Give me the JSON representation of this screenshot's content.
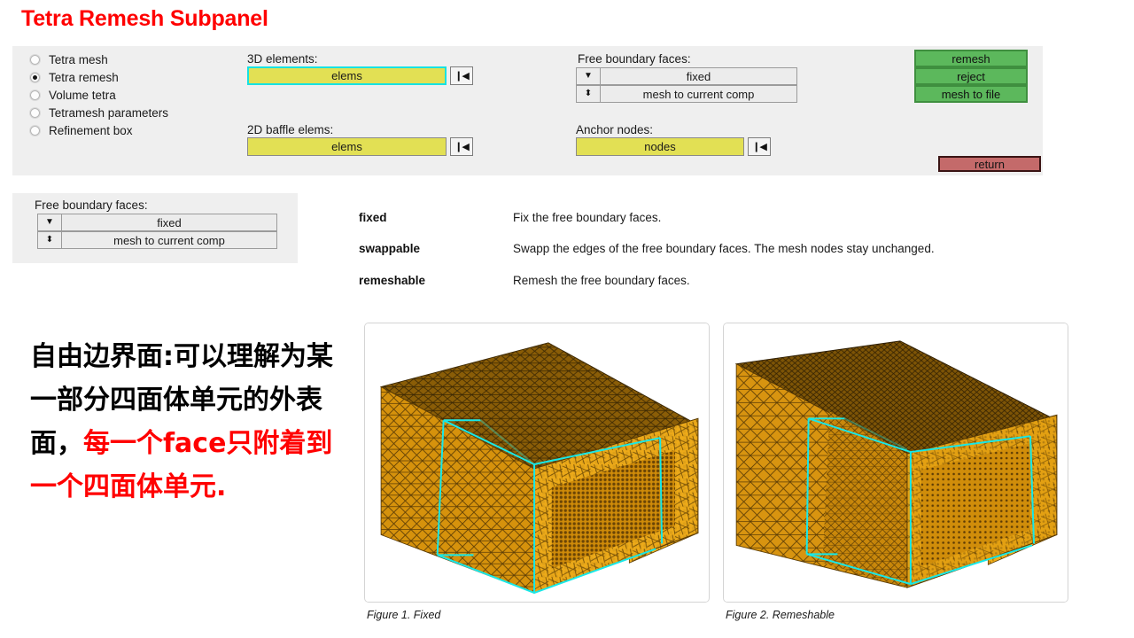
{
  "page": {
    "title": "Tetra Remesh Subpanel",
    "title_color": "#ff0000",
    "background": "#ffffff"
  },
  "main_panel": {
    "background": "#efefef",
    "mode_radios": [
      {
        "label": "Tetra mesh",
        "selected": false
      },
      {
        "label": "Tetra remesh",
        "selected": true
      },
      {
        "label": "Volume tetra",
        "selected": false
      },
      {
        "label": "Tetramesh parameters",
        "selected": false
      },
      {
        "label": "Refinement box",
        "selected": false
      }
    ],
    "collectors": [
      {
        "label": "3D elements:",
        "value": "elems",
        "active": true,
        "reset_icon": "skip-back-icon"
      },
      {
        "label": "2D baffle elems:",
        "value": "elems",
        "active": false,
        "reset_icon": "skip-back-icon"
      },
      {
        "label": "Anchor nodes:",
        "value": "nodes",
        "active": false,
        "reset_icon": "skip-back-icon"
      }
    ],
    "free_boundary": {
      "label": "Free boundary faces:",
      "mode_value": "fixed",
      "mode_icon": "chevron-down-icon",
      "dest_value": "mesh to current comp",
      "dest_icon": "up-down-arrow-icon"
    },
    "action_buttons": [
      {
        "label": "remesh",
        "color": "#5cb85c"
      },
      {
        "label": "reject",
        "color": "#5cb85c"
      },
      {
        "label": "mesh to file",
        "color": "#5cb85c"
      }
    ],
    "return_button": {
      "label": "return",
      "color": "#c46a6a"
    }
  },
  "sub_panel": {
    "background": "#efefef",
    "label": "Free boundary faces:",
    "mode_value": "fixed",
    "mode_icon": "chevron-down-icon",
    "dest_value": "mesh to current comp",
    "dest_icon": "up-down-arrow-icon"
  },
  "definitions": [
    {
      "term": "fixed",
      "desc": "Fix the free boundary faces."
    },
    {
      "term": "swappable",
      "desc": "Swapp the edges of the free boundary faces. The mesh nodes stay unchanged."
    },
    {
      "term": "remeshable",
      "desc": "Remesh the free boundary faces."
    }
  ],
  "note": {
    "line1": "自由边界面:可以理解为某",
    "line2": "一部分四面体单元的外表",
    "line3_black": "面，",
    "line3_red": "每一个face只附着到",
    "line4_red": "一个四面体单元.",
    "highlight_color": "#ff0000"
  },
  "figures": [
    {
      "caption": "Figure 1. Fixed",
      "alt": "tetra mesh block with coarse fixed free boundary faces and cyan refinement box"
    },
    {
      "caption": "Figure 2. Remeshable",
      "alt": "tetra mesh block with remeshed fine free boundary faces and cyan refinement box"
    }
  ]
}
